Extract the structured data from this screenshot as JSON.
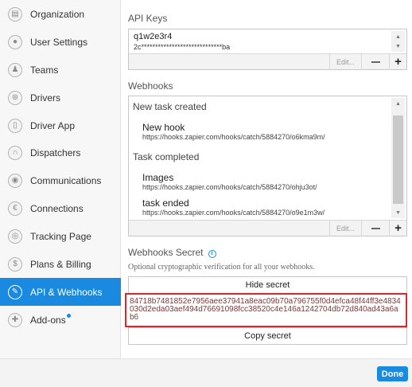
{
  "sidebar": {
    "items": [
      {
        "label": "Organization",
        "icon": "building-icon",
        "glyph": "▤"
      },
      {
        "label": "User Settings",
        "icon": "user-icon",
        "glyph": "●"
      },
      {
        "label": "Teams",
        "icon": "team-icon",
        "glyph": "♟"
      },
      {
        "label": "Drivers",
        "icon": "steering-wheel-icon",
        "glyph": "⊛"
      },
      {
        "label": "Driver App",
        "icon": "phone-icon",
        "glyph": "▯"
      },
      {
        "label": "Dispatchers",
        "icon": "headset-icon",
        "glyph": "∩"
      },
      {
        "label": "Communications",
        "icon": "chat-icon",
        "glyph": "◉"
      },
      {
        "label": "Connections",
        "icon": "connection-icon",
        "glyph": "€"
      },
      {
        "label": "Tracking Page",
        "icon": "target-icon",
        "glyph": "◎"
      },
      {
        "label": "Plans & Billing",
        "icon": "dollar-icon",
        "glyph": "$"
      },
      {
        "label": "API & Webhooks",
        "icon": "wrench-icon",
        "glyph": "✎",
        "active": true
      },
      {
        "label": "Add-ons",
        "icon": "puzzle-icon",
        "glyph": "✚",
        "badge": true
      }
    ]
  },
  "api_keys": {
    "title": "API Keys",
    "name": "q1w2e3r4",
    "masked_key": "2c*****************************ba",
    "edit_label": "Edit..."
  },
  "webhooks": {
    "title": "Webhooks",
    "groups": [
      {
        "label": "New task created",
        "items": [
          {
            "name": "New hook",
            "url": "https://hooks.zapier.com/hooks/catch/5884270/o6kma9m/"
          }
        ]
      },
      {
        "label": "Task completed",
        "items": [
          {
            "name": "Images",
            "url": "https://hooks.zapier.com/hooks/catch/5884270/ohju3ot/"
          },
          {
            "name": "task ended",
            "url": "https://hooks.zapier.com/hooks/catch/5884270/o9e1m3w/"
          }
        ]
      }
    ],
    "edit_label": "Edit..."
  },
  "secret": {
    "title": "Webhooks Secret",
    "info_glyph": "i",
    "description": "Optional cryptographic verification for all your webhooks.",
    "hide_label": "Hide secret",
    "value": "84718b7481852e7956aee37941a8eac09b70a796755f0d4efca48f44ff3e4834030d2eda03aef494d76691098fcc38520c4e146a1242704db72d840ad43a6ab6",
    "copy_label": "Copy secret"
  },
  "footer": {
    "done_label": "Done"
  },
  "colors": {
    "accent": "#1a8ae0",
    "highlight_border": "#e0252a"
  }
}
